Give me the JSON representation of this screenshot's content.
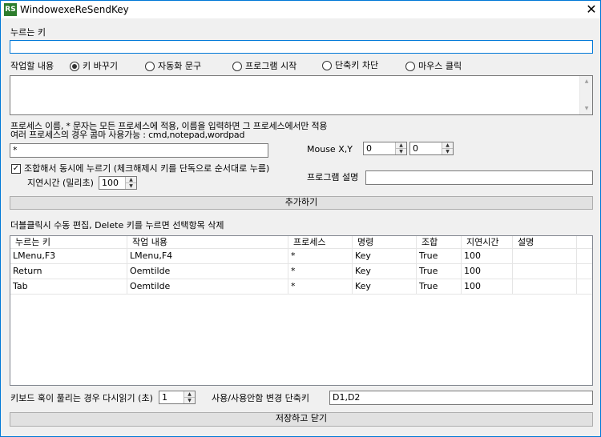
{
  "window": {
    "icon_text": "RS",
    "title": "WindowexeReSendKey",
    "close_glyph": "✕"
  },
  "key_field": {
    "label": "누르는 키",
    "value": ""
  },
  "action": {
    "label": "작업할 내용",
    "options": [
      {
        "label": "키 바꾸기",
        "selected": true
      },
      {
        "label": "자동화 문구",
        "selected": false
      },
      {
        "label": "프로그램 시작",
        "selected": false
      },
      {
        "label": "단축키 차단",
        "selected": false
      },
      {
        "label": "마우스 클릭",
        "selected": false
      }
    ],
    "text_value": ""
  },
  "process": {
    "help_line1": "프로세스 이름, * 문자는 모든 프로세스에 적용, 이름을 입력하면 그 프로세스에서만 적용",
    "help_line2": "여러 프로세스의 경우 콤마 사용가능 : cmd,notepad,wordpad",
    "value": "*"
  },
  "mouse": {
    "label": "Mouse X,Y",
    "x": "0",
    "y": "0"
  },
  "combo": {
    "label": "조합해서 동시에 누르기 (체크해제시 키를 단독으로 순서대로 누름)",
    "checked": true,
    "check_glyph": "✓"
  },
  "delay": {
    "label": "지연시간 (밀리초)",
    "value": "100"
  },
  "program_desc": {
    "label": "프로그램 설명",
    "value": ""
  },
  "add_button": "추가하기",
  "list": {
    "caption": "더블클릭시 수동 편집, Delete 키를 누르면 선택항목 삭제",
    "columns": [
      "누르는 키",
      "작업 내용",
      "프로세스",
      "명령",
      "조합",
      "지연시간",
      "설명"
    ],
    "rows": [
      [
        "LMenu,F3",
        "LMenu,F4",
        "*",
        "Key",
        "True",
        "100",
        ""
      ],
      [
        "Return",
        "Oemtilde",
        "*",
        "Key",
        "True",
        "100",
        ""
      ],
      [
        "Tab",
        "Oemtilde",
        "*",
        "Key",
        "True",
        "100",
        ""
      ]
    ]
  },
  "reread": {
    "label": "키보드 훅이 풀리는 경우 다시읽기 (초)",
    "value": "1"
  },
  "toggle_hotkey": {
    "label": "사용/사용안함 변경 단축키",
    "value": "D1,D2"
  },
  "save_button": "저장하고 닫기",
  "icons": {
    "spin_up": "▲",
    "spin_down": "▼",
    "scroll_up": "▲",
    "scroll_down": "▼"
  }
}
